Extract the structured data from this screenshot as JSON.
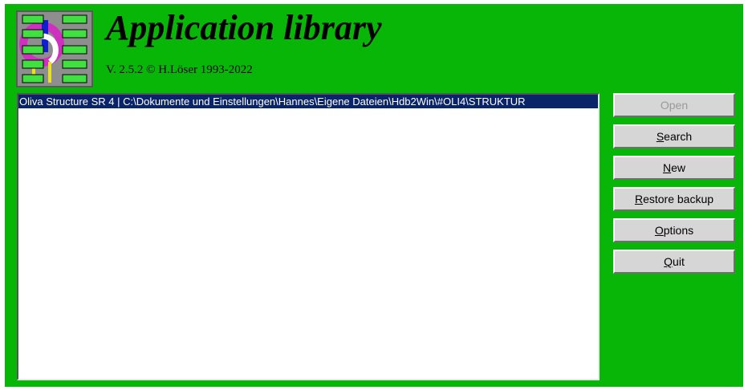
{
  "app": {
    "title": "Application library",
    "version": "V. 2.5.2 © H.Löser 1993-2022"
  },
  "list": {
    "items": [
      {
        "label": "Oliva Structure SR 4 | C:\\Dokumente und Einstellungen\\Hannes\\Eigene Dateien\\Hdb2Win\\#OLI4\\STRUKTUR",
        "selected": true
      }
    ]
  },
  "buttons": {
    "open": {
      "label": "Open",
      "enabled": false
    },
    "search": {
      "label": "Search",
      "accel": "S",
      "rest": "earch",
      "enabled": true
    },
    "new": {
      "label": "New",
      "accel": "N",
      "rest": "ew",
      "enabled": true
    },
    "restore": {
      "label": "Restore backup",
      "accel": "R",
      "rest": "estore backup",
      "enabled": true
    },
    "options": {
      "label": "Options",
      "accel": "O",
      "rest": "ptions",
      "enabled": true
    },
    "quit": {
      "label": "Quit",
      "accel": "Q",
      "rest": "uit",
      "enabled": true
    }
  },
  "colors": {
    "window_bg": "#08b608",
    "selection_bg": "#0a246a",
    "button_face": "#d6d6d6"
  }
}
